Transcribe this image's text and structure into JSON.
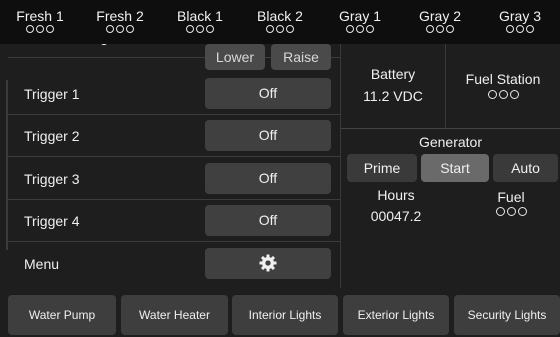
{
  "tanks": [
    {
      "name": "Fresh 1",
      "icon": "level-dots"
    },
    {
      "name": "Fresh 2",
      "icon": "level-dots"
    },
    {
      "name": "Black 1",
      "icon": "level-dots"
    },
    {
      "name": "Black 2",
      "icon": "level-dots"
    },
    {
      "name": "Gray 1",
      "icon": "level-dots"
    },
    {
      "name": "Gray 2",
      "icon": "level-dots"
    },
    {
      "name": "Gray 3",
      "icon": "level-dots"
    }
  ],
  "left": {
    "landing_jacks": {
      "label": "Rear Landing Jacks",
      "lower": "Lower",
      "raise": "Raise"
    },
    "rows": [
      {
        "label": "Trigger 1",
        "value": "Off"
      },
      {
        "label": "Trigger 2",
        "value": "Off"
      },
      {
        "label": "Trigger 3",
        "value": "Off"
      },
      {
        "label": "Trigger 4",
        "value": "Off"
      }
    ],
    "menu": {
      "label": "Menu",
      "icon": "gear-icon"
    }
  },
  "right": {
    "battery": {
      "label": "Battery",
      "value": "11.2 VDC"
    },
    "fuel_station": {
      "label": "Fuel Station",
      "icon": "level-dots"
    },
    "generator": {
      "title": "Generator",
      "prime": "Prime",
      "start": "Start",
      "auto": "Auto",
      "hours_label": "Hours",
      "hours_value": "00047.2",
      "fuel_label": "Fuel",
      "fuel_icon": "level-dots"
    }
  },
  "bottom": {
    "buttons": [
      "Water Pump",
      "Water Heater",
      "Interior Lights",
      "Exterior Lights",
      "Security Lights"
    ]
  },
  "colors": {
    "background": "#1e1e1e",
    "button": "#404040",
    "active_button": "#6a6a6a"
  }
}
